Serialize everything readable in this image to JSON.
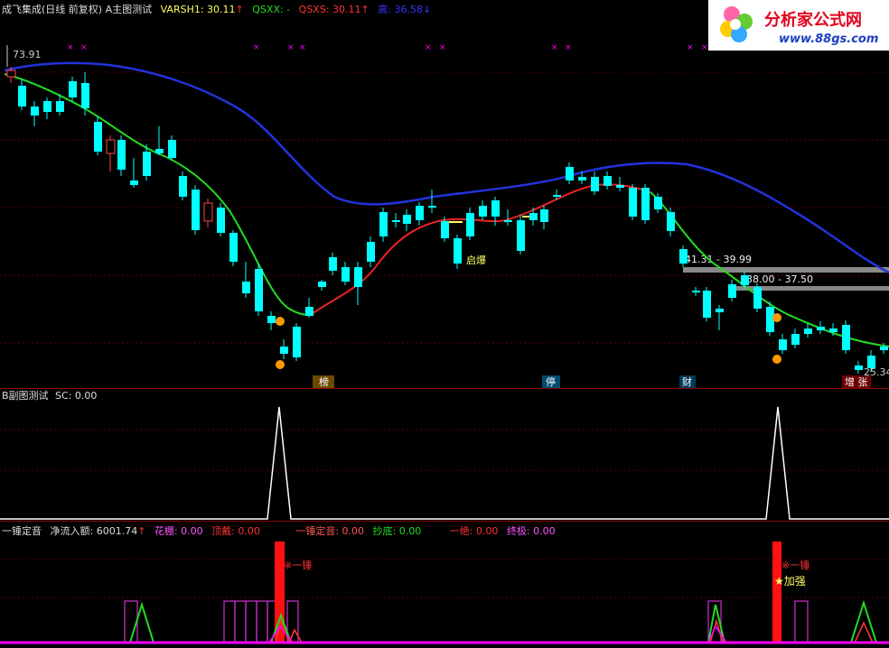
{
  "main_panel": {
    "title": "成飞集成(日线 前复权) A主图测试",
    "varsh1": "VARSH1: 30.11",
    "qsxx": "QSXX: -",
    "qsxs": "QSXS: 30.11",
    "gao": "高: 36.58",
    "price_high_label": "73.91",
    "price_low_label": "25.34",
    "annotation_qibao": "启爆",
    "band1": "41.31 - 39.99",
    "band2": "38.00 - 37.50",
    "bottom_tags": [
      "榜",
      "停",
      "财",
      "增 张"
    ]
  },
  "sub_panel_b": {
    "title": "B副图测试",
    "sc": "SC: 0.00"
  },
  "sub_panel_c": {
    "title": "一锤定音",
    "inflow": "净流入额: 6001.74",
    "huapeng": "花棚: 0.00",
    "dingdai": "顶戴: 0.00",
    "yichui": "一锤定音: 0.00",
    "chaodi": "抄底: 0.00",
    "yijue": "一绝: 0.00",
    "zhongji": "终极: 0.00",
    "label_yichui_1": "※一锤",
    "label_yichui_2": "※一锤",
    "label_jiaqiang": "★加强"
  },
  "logo": {
    "name": "分析家公式网",
    "url": "www.88gs.com"
  },
  "colors": {
    "up": "#ff3333",
    "down": "#00ffff",
    "ma_slow": "#2222dd",
    "ma_green": "#22dd22",
    "ma_red": "#ee2222",
    "magenta": "#ff00ff"
  }
}
